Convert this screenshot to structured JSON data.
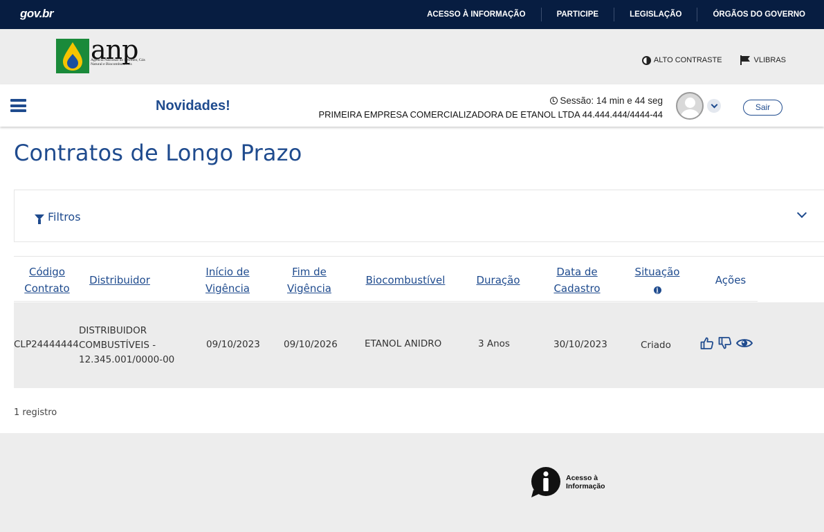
{
  "govbar": {
    "logo": "gov.br",
    "links": [
      "ACESSO À INFORMAÇÃO",
      "PARTICIPE",
      "LEGISLAÇÃO",
      "ÓRGÃOS DO GOVERNO"
    ]
  },
  "header": {
    "logo_text": "anp",
    "logo_subtitle": "Agência Nacional do Petróleo, Gás Natural e Biocombustíveis",
    "high_contrast": "ALTO CONTRASTE",
    "vlibras": "VLIBRAS"
  },
  "session": {
    "novidades": "Novidades!",
    "time": "Sessão: 14 min e 44 seg",
    "company": "PRIMEIRA EMPRESA COMERCIALIZADORA DE ETANOL LTDA 44.444.444/4444-44",
    "logout": "Sair"
  },
  "main": {
    "title": "Contratos de Longo Prazo",
    "filters_label": "Filtros",
    "columns": {
      "codigo": [
        "Código",
        "Contrato"
      ],
      "distribuidor": "Distribuidor",
      "inicio": [
        "Início de",
        "Vigência"
      ],
      "fim": [
        "Fim de",
        "Vigência"
      ],
      "bio": "Biocombustível",
      "duracao": "Duração",
      "cadastro": [
        "Data de",
        "Cadastro"
      ],
      "situacao": "Situação",
      "acoes": "Ações"
    },
    "rows": [
      {
        "codigo": "CLP24444444",
        "distribuidor": [
          "DISTRIBUIDOR",
          "COMBUSTÍVEIS -",
          "12.345.001/0000-00"
        ],
        "inicio": "09/10/2023",
        "fim": "09/10/2026",
        "bio": "ETANOL ANIDRO",
        "duracao": "3 Anos",
        "cadastro": "30/10/2023",
        "situacao": "Criado"
      }
    ],
    "record_count": "1 registro"
  },
  "footer": {
    "acesso_info": [
      "Acesso à",
      "Informação"
    ]
  },
  "colors": {
    "gov_navy": "#071d41",
    "brand_blue": "#1f4b8e",
    "header_gray": "#ededed",
    "row_gray": "#ececec"
  },
  "icons": {
    "hamburger": "menu-icon",
    "clock": "clock-icon",
    "contrast": "contrast-icon",
    "vlibras": "flag-hands-icon",
    "filter": "funnel-icon",
    "approve": "thumbs-up-icon",
    "reject": "thumbs-down-icon",
    "view": "eye-icon",
    "info": "info-icon"
  }
}
